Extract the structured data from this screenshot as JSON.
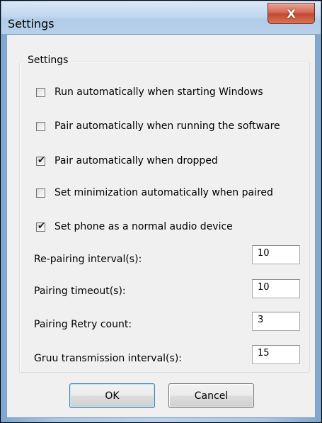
{
  "window": {
    "title": "Settings",
    "close_glyph": "X"
  },
  "group": {
    "legend": "Settings"
  },
  "checkboxes": [
    {
      "label": "Run automatically when starting Windows",
      "checked": false
    },
    {
      "label": "Pair automatically when running the software",
      "checked": false
    },
    {
      "label": "Pair automatically when dropped",
      "checked": true
    },
    {
      "label": "Set minimization automatically when paired",
      "checked": false
    },
    {
      "label": "Set phone as a normal audio device",
      "checked": true
    }
  ],
  "fields": [
    {
      "label": "Re-pairing interval(s):",
      "value": "10"
    },
    {
      "label": "Pairing timeout(s):",
      "value": "10"
    },
    {
      "label": "Pairing Retry count:",
      "value": "3"
    },
    {
      "label": "Gruu transmission interval(s):",
      "value": "15"
    }
  ],
  "buttons": {
    "ok_label": "OK",
    "cancel_label": "Cancel"
  },
  "icons": {
    "close": "close-icon",
    "check": "checkmark-icon"
  }
}
